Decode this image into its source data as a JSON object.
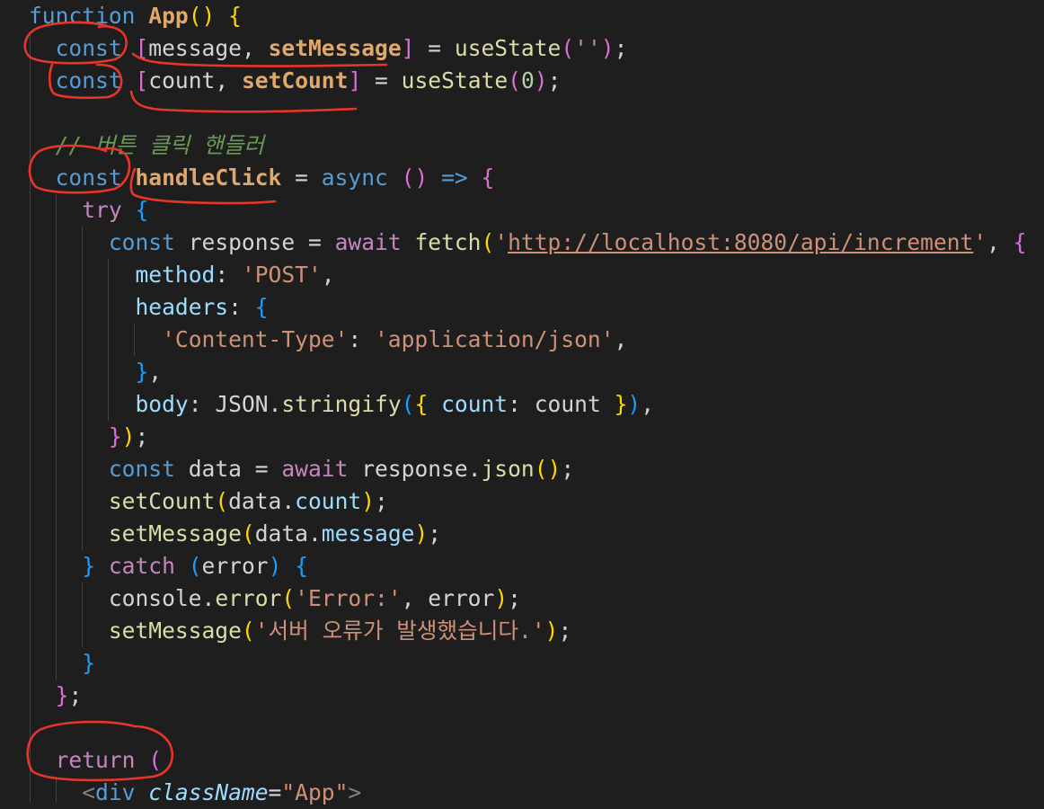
{
  "editor": {
    "comment": "// 버튼 클릭 핸들러",
    "url": "http://localhost:8080/api/increment",
    "strings": {
      "empty": "''",
      "method": "'POST'",
      "content_type_key": "'Content-Type'",
      "content_type_val": "'application/json'",
      "error_label": "'Error:'",
      "server_error": "'서버 오류가 발생했습니다.'",
      "app_class": "\"App\""
    },
    "number_zero": "0"
  },
  "colors": {
    "background": "#1e1e1e",
    "annotation": "#e8352a"
  }
}
